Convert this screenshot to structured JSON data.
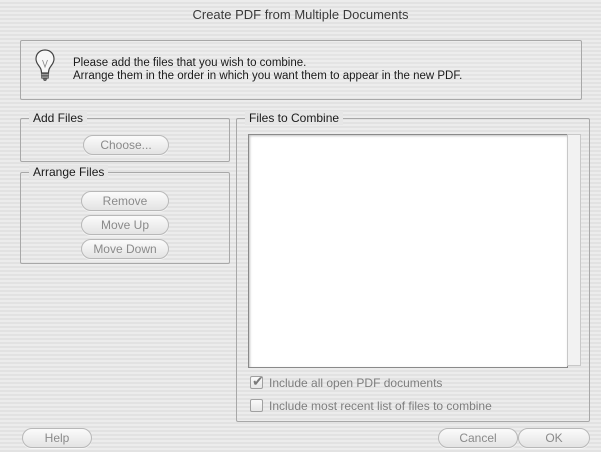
{
  "window": {
    "title": "Create PDF from Multiple Documents"
  },
  "info": {
    "icon": "lightbulb-icon",
    "line1": "Please add the files that you wish to combine.",
    "line2": "Arrange them in the order in which you want them to appear in the new PDF."
  },
  "add_files": {
    "legend": "Add Files",
    "choose_label": "Choose..."
  },
  "arrange_files": {
    "legend": "Arrange Files",
    "remove_label": "Remove",
    "move_up_label": "Move Up",
    "move_down_label": "Move Down"
  },
  "files_to_combine": {
    "legend": "Files to Combine",
    "items": []
  },
  "options": {
    "include_open": {
      "label": "Include all open PDF documents",
      "checked": true
    },
    "include_recent": {
      "label": "Include most recent list of files to combine",
      "checked": false
    }
  },
  "footer": {
    "help_label": "Help",
    "cancel_label": "Cancel",
    "ok_label": "OK"
  }
}
